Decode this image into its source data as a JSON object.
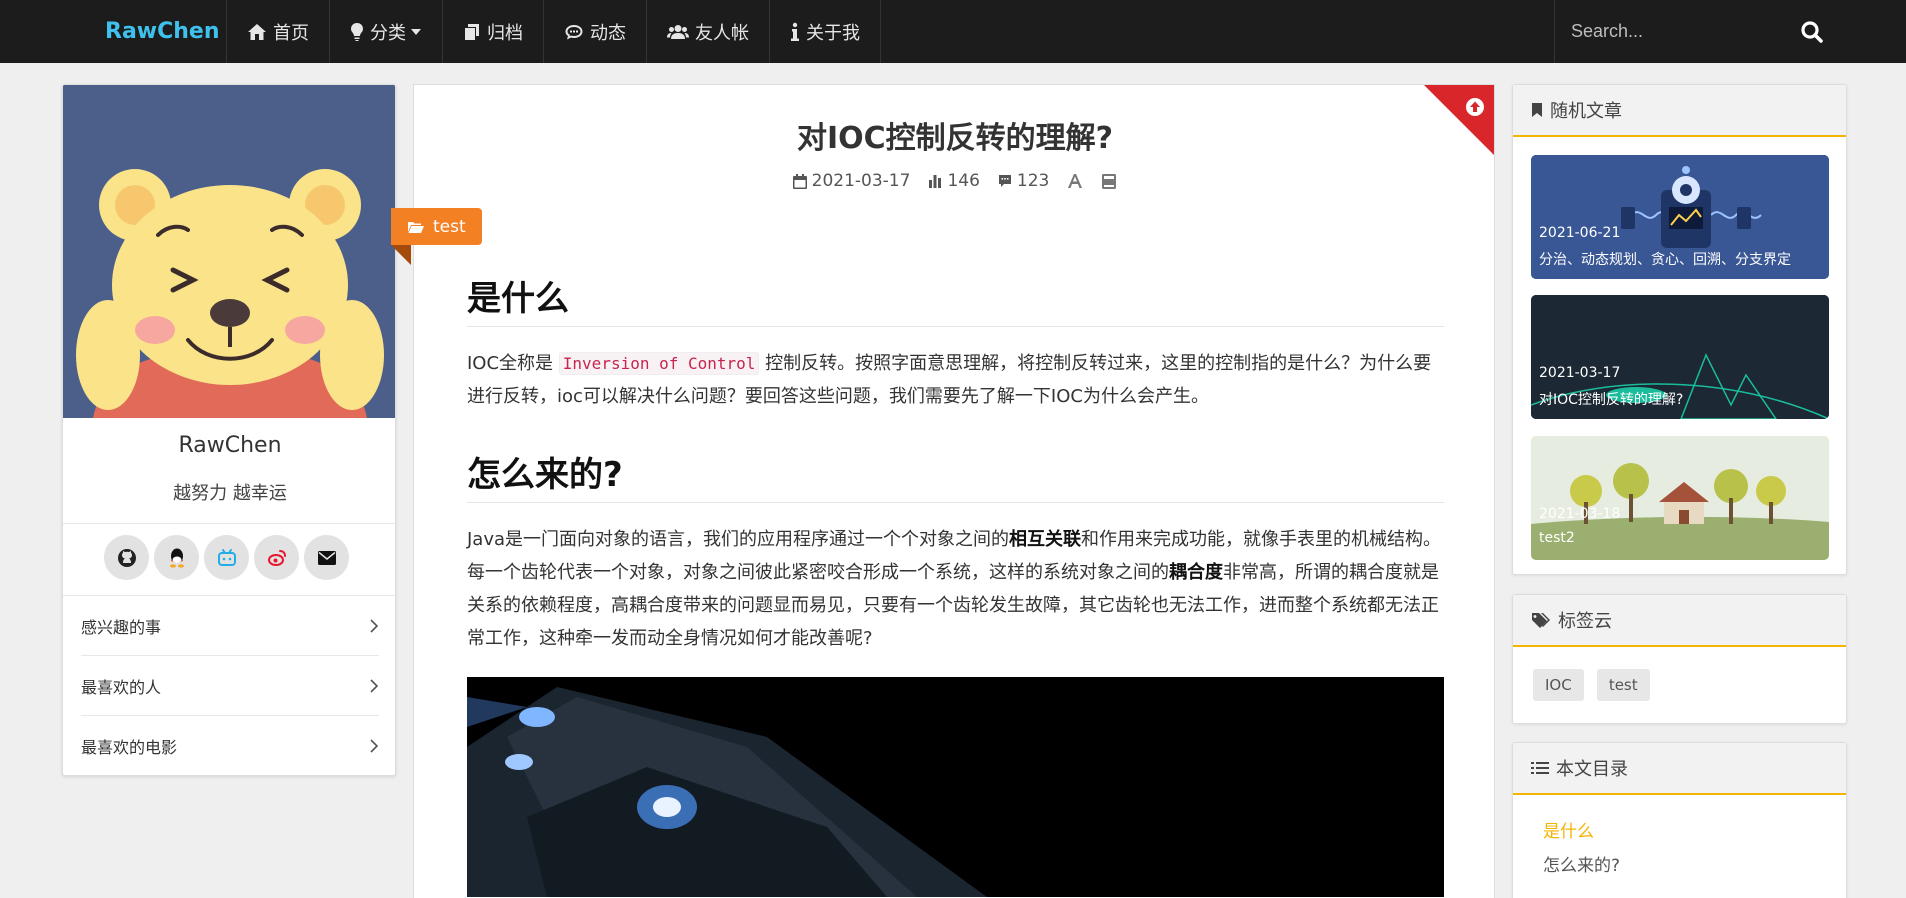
{
  "navbar": {
    "brand": "RawChen",
    "items": [
      {
        "label": "首页",
        "icon": "home-icon"
      },
      {
        "label": "分类",
        "icon": "lightbulb-icon"
      },
      {
        "label": "归档",
        "icon": "copy-icon"
      },
      {
        "label": "动态",
        "icon": "comment-icon"
      },
      {
        "label": "友人帐",
        "icon": "users-icon"
      },
      {
        "label": "关于我",
        "icon": "info-icon"
      }
    ],
    "search_placeholder": "Search..."
  },
  "profile": {
    "name": "RawChen",
    "motto": "越努力 越幸运",
    "social_icons": [
      "github-icon",
      "qq-icon",
      "bilibili-icon",
      "weibo-icon",
      "email-icon"
    ],
    "links": [
      "感兴趣的事",
      "最喜欢的人",
      "最喜欢的电影"
    ]
  },
  "article": {
    "title": "对IOC控制反转的理解?",
    "date": "2021-03-17",
    "views": "146",
    "comments": "123",
    "category_tag": "test",
    "h2_1": "是什么",
    "p1_a": "IOC全称是 ",
    "p1_code": "Inversion of Control",
    "p1_b": " 控制反转。按照字面意思理解，将控制反转过来，这里的控制指的是什么？为什么要进行反转，ioc可以解决什么问题？要回答这些问题，我们需要先了解一下IOC为什么会产生。",
    "h2_2": "怎么来的?",
    "p2_a": "Java是一门面向对象的语言，我们的应用程序通过一个个对象之间的",
    "p2_b1": "相互关联",
    "p2_b": "和作用来完成功能，就像手表里的机械结构。每一个齿轮代表一个对象，对象之间彼此紧密咬合形成一个系统，这样的系统对象之间的",
    "p2_b2": "耦合度",
    "p2_c": "非常高，所谓的耦合度就是关系的依赖程度，高耦合度带来的问题显而易见，只要有一个齿轮发生故障，其它齿轮也无法工作，进而整个系统都无法正常工作，这种牵一发而动全身情况如何才能改善呢?"
  },
  "sidebar": {
    "random_title": "随机文章",
    "random_posts": [
      {
        "date": "2021-06-21",
        "title": "分治、动态规划、贪心、回溯、分支界定"
      },
      {
        "date": "2021-03-17",
        "title": "对IOC控制反转的理解?"
      },
      {
        "date": "2021-03-18",
        "title": "test2"
      }
    ],
    "tags_title": "标签云",
    "tags": [
      "IOC",
      "test"
    ],
    "toc_title": "本文目录",
    "toc": [
      "是什么",
      "怎么来的?"
    ]
  },
  "colors": {
    "accent": "#3fc1ee",
    "ribbon": "#f48024",
    "corner": "#d9262b",
    "widget_underline": "#f5b400",
    "toc_active": "#f5b400"
  }
}
